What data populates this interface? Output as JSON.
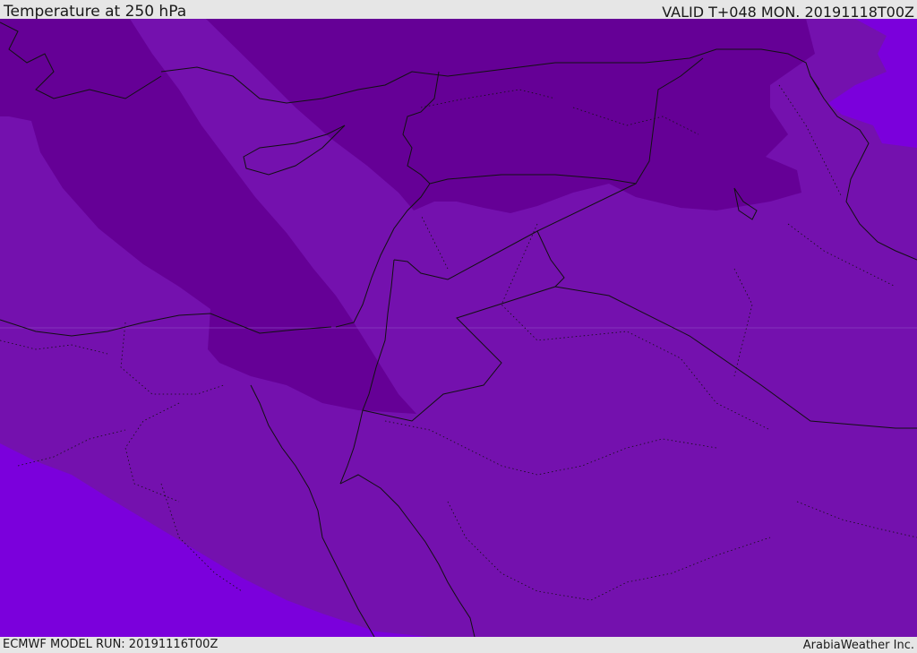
{
  "header": {
    "title": "Temperature at 250 hPa",
    "valid": "VALID T+048 MON. 20191118T00Z"
  },
  "footer": {
    "model_run": "ECMWF MODEL RUN: 20191116T00Z",
    "credit": "ArabiaWeather Inc."
  },
  "map": {
    "colors": {
      "base": "#7411ae",
      "cold": "#650096",
      "warm": "#7b00dc",
      "border": "#111111",
      "gridline": "#8a3fc0"
    }
  }
}
